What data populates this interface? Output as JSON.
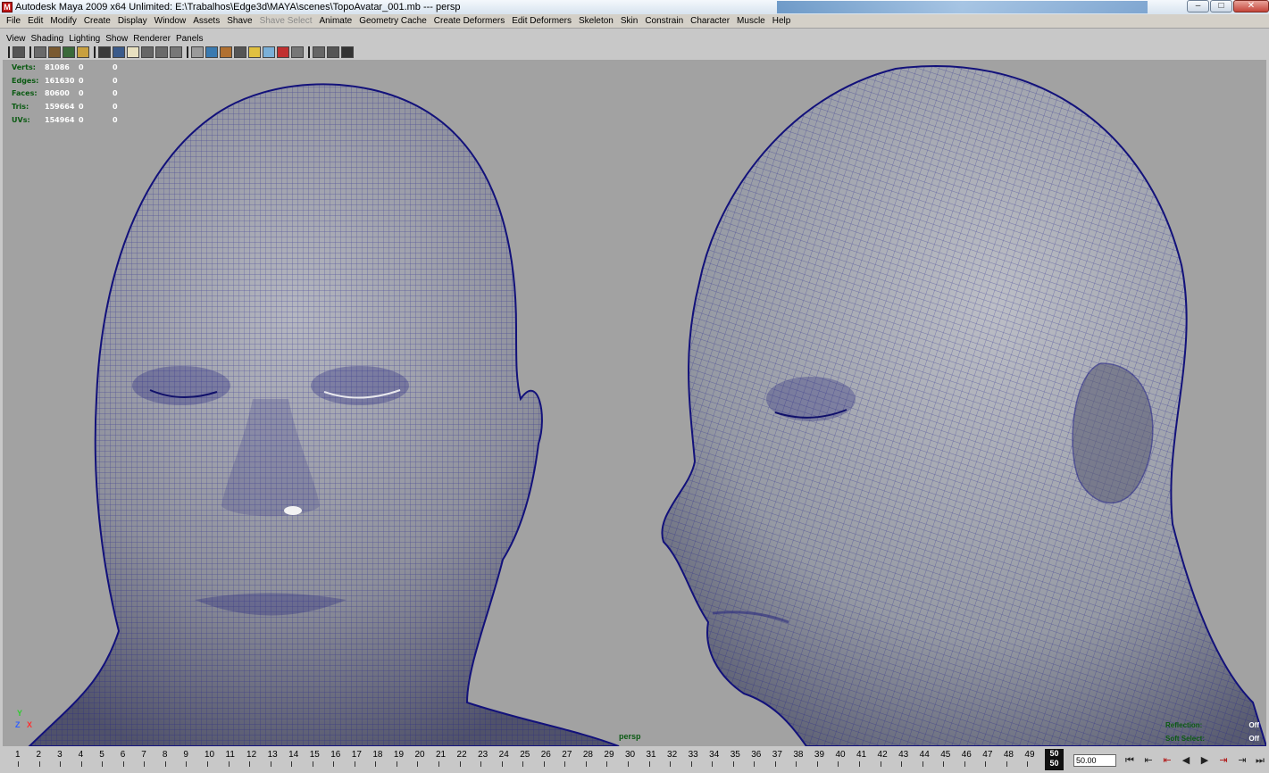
{
  "window": {
    "title": "Autodesk Maya 2009 x64 Unlimited: E:\\Trabalhos\\Edge3d\\MAYA\\scenes\\TopoAvatar_001.mb   ---   persp",
    "app_icon": "maya-icon",
    "buttons": {
      "minimize": "–",
      "maximize": "□",
      "close": "✕"
    }
  },
  "menubar": {
    "items": [
      {
        "label": "File"
      },
      {
        "label": "Edit"
      },
      {
        "label": "Modify"
      },
      {
        "label": "Create"
      },
      {
        "label": "Display"
      },
      {
        "label": "Window"
      },
      {
        "label": "Assets"
      },
      {
        "label": "Shave"
      },
      {
        "label": "Shave Select",
        "disabled": true
      },
      {
        "label": "Animate"
      },
      {
        "label": "Geometry Cache"
      },
      {
        "label": "Create Deformers"
      },
      {
        "label": "Edit Deformers"
      },
      {
        "label": "Skeleton"
      },
      {
        "label": "Skin"
      },
      {
        "label": "Constrain"
      },
      {
        "label": "Character"
      },
      {
        "label": "Muscle"
      },
      {
        "label": "Help"
      }
    ]
  },
  "panel_menu": {
    "items": [
      {
        "label": "View"
      },
      {
        "label": "Shading"
      },
      {
        "label": "Lighting"
      },
      {
        "label": "Show"
      },
      {
        "label": "Renderer"
      },
      {
        "label": "Panels"
      }
    ]
  },
  "toolbar": {
    "icons": [
      "select-camera-icon",
      "lock-camera-icon",
      "camera-attributes-icon",
      "bookmark-icon",
      "image-plane-icon",
      "grid-icon",
      "film-gate-icon",
      "resolution-gate-icon",
      "gate-mask-icon",
      "field-chart-icon",
      "safe-action-icon",
      "wireframe-icon",
      "smooth-shade-icon",
      "wireframe-on-shaded-icon",
      "textured-icon",
      "use-lights-icon",
      "shadows-icon",
      "high-quality-icon",
      "isolate-select-icon",
      "xray-icon",
      "xray-joints-icon",
      "frame-all-icon"
    ]
  },
  "hud": {
    "rows": [
      {
        "label": "Verts:",
        "value": "81086",
        "sel": "0",
        "comp": "0"
      },
      {
        "label": "Edges:",
        "value": "161630",
        "sel": "0",
        "comp": "0"
      },
      {
        "label": "Faces:",
        "value": "80600",
        "sel": "0",
        "comp": "0"
      },
      {
        "label": "Tris:",
        "value": "159664",
        "sel": "0",
        "comp": "0"
      },
      {
        "label": "UVs:",
        "value": "154964",
        "sel": "0",
        "comp": "0"
      }
    ]
  },
  "axis": {
    "y": "Y",
    "z": "Z",
    "x": "X"
  },
  "camera_label": "persp",
  "options": [
    {
      "label": "Reflection:",
      "value": "Off"
    },
    {
      "label": "Soft Select:",
      "value": "Off"
    }
  ],
  "timeline": {
    "start": 1,
    "end": 50,
    "current_frame": "50",
    "current_frame_sub": "50",
    "frame_field": "50.00"
  },
  "playback": {
    "buttons": [
      "go-to-start-icon",
      "step-back-frame-icon",
      "step-back-key-icon",
      "play-backwards-icon",
      "play-forwards-icon",
      "step-forward-key-icon",
      "step-forward-frame-icon",
      "go-to-end-icon"
    ]
  },
  "colors": {
    "viewport_bg": "#a2a2a2",
    "wireframe": "#1b1a8c",
    "mesh_shade": "#8d8f99",
    "hud_label": "#0a5a12"
  }
}
